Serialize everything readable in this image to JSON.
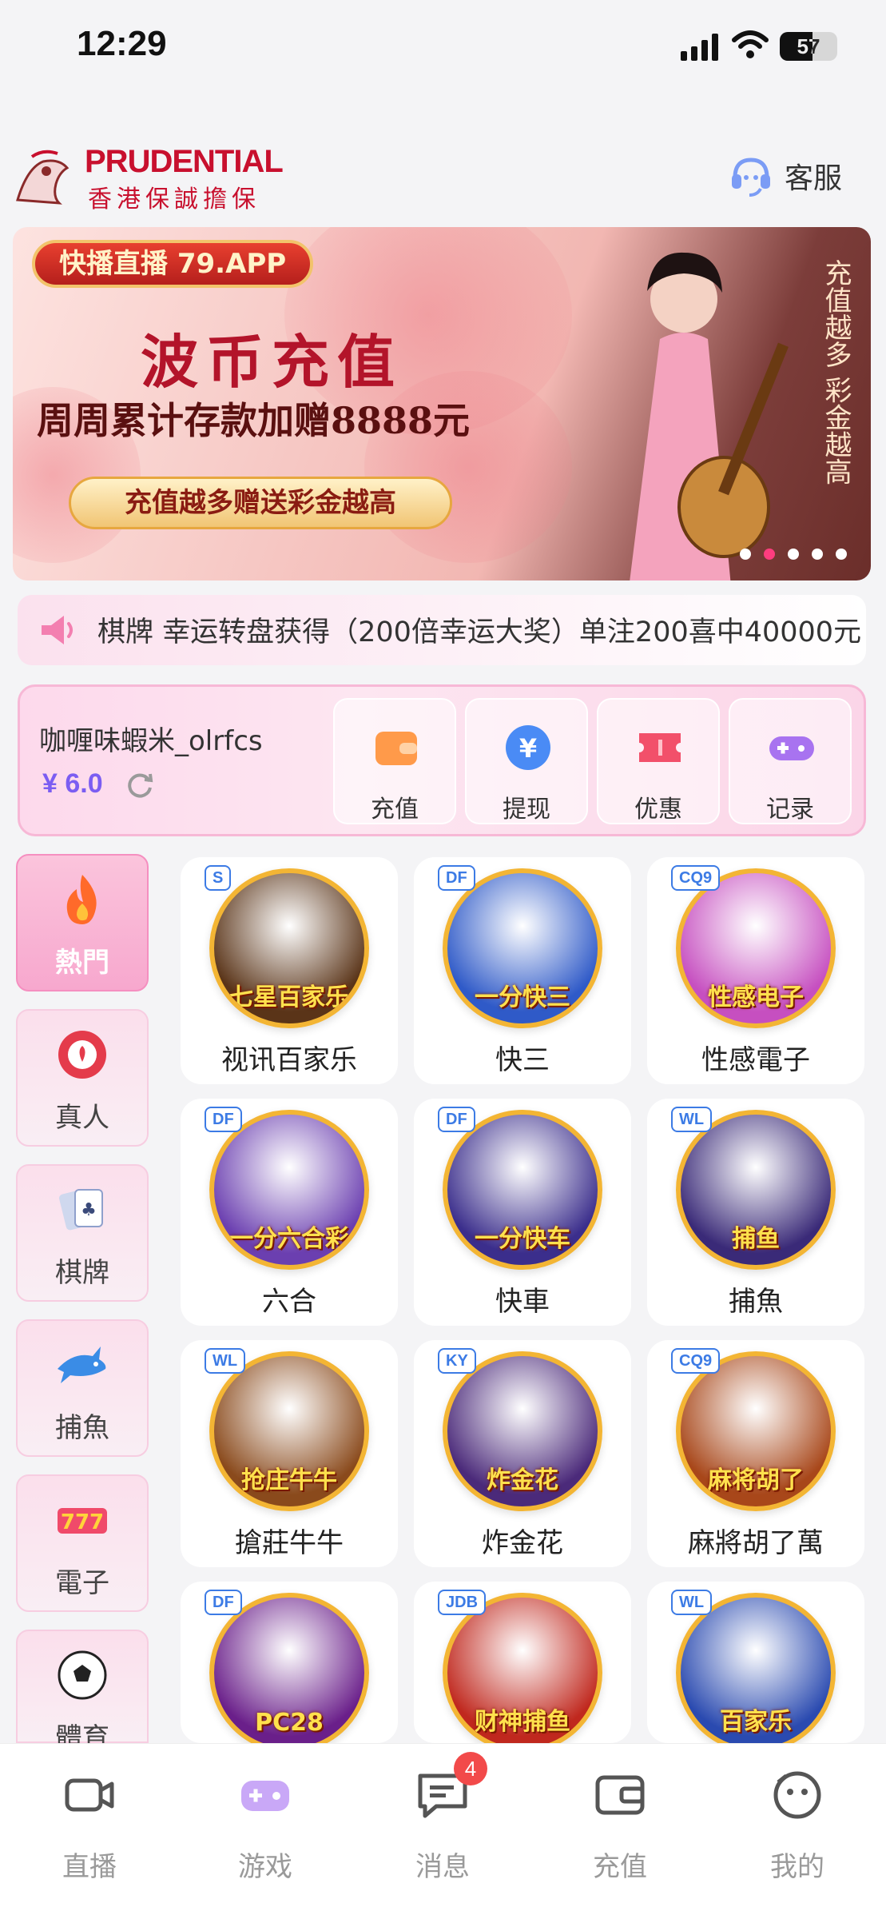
{
  "status_bar": {
    "time": "12:29",
    "battery": "57"
  },
  "header": {
    "brand": "PRUDENTIAL",
    "brand_sub": "香港保誠擔保",
    "support_label": "客服"
  },
  "banner": {
    "tag": "快播直播 79.APP",
    "title": "波币充值",
    "subtitle": "周周累计存款加赠8888元",
    "pill": "充值越多赠送彩金越高",
    "side_text": "充值越多 彩金越高",
    "slide_count": 5,
    "active_slide": 2
  },
  "marquee": {
    "text": "棋牌 幸运转盘获得（200倍幸运大奖）单注200喜中40000元"
  },
  "wallet": {
    "username": "咖喱味蝦米_olrfcs",
    "balance": "¥ 6.0",
    "actions": [
      {
        "label": "充值",
        "icon": "wallet-icon",
        "color": "#ff9a4a"
      },
      {
        "label": "提现",
        "icon": "yen-icon",
        "color": "#4a8bf5"
      },
      {
        "label": "优惠",
        "icon": "ticket-icon",
        "color": "#f2506a"
      },
      {
        "label": "记录",
        "icon": "gamepad-icon",
        "color": "#a873f0"
      }
    ]
  },
  "categories": [
    {
      "label": "熱門",
      "icon": "flame-icon",
      "active": true
    },
    {
      "label": "真人",
      "icon": "chip-icon",
      "active": false
    },
    {
      "label": "棋牌",
      "icon": "cards-icon",
      "active": false
    },
    {
      "label": "捕魚",
      "icon": "shark-icon",
      "active": false
    },
    {
      "label": "電子",
      "icon": "slot-777-icon",
      "active": false
    },
    {
      "label": "體育",
      "icon": "soccer-ball-icon",
      "active": false
    }
  ],
  "games": [
    {
      "label": "视讯百家乐",
      "caption": "七星百家乐",
      "provider": "S",
      "bg": "#5a3418"
    },
    {
      "label": "快三",
      "caption": "一分快三",
      "provider": "DF",
      "bg": "#2f5ac8"
    },
    {
      "label": "性感電子",
      "caption": "性感电子",
      "provider": "CQ9",
      "bg": "#c64fc0"
    },
    {
      "label": "六合",
      "caption": "一分六合彩",
      "provider": "DF",
      "bg": "#6b3fb0"
    },
    {
      "label": "快車",
      "caption": "一分快车",
      "provider": "DF",
      "bg": "#3b2e8c"
    },
    {
      "label": "捕魚",
      "caption": "捕鱼",
      "provider": "WL",
      "bg": "#3a2a78"
    },
    {
      "label": "搶莊牛牛",
      "caption": "抢庄牛牛",
      "provider": "WL",
      "bg": "#8a4a1c"
    },
    {
      "label": "炸金花",
      "caption": "炸金花",
      "provider": "KY",
      "bg": "#4b2a7a"
    },
    {
      "label": "麻將胡了萬",
      "caption": "麻将胡了",
      "provider": "CQ9",
      "bg": "#a8471a"
    },
    {
      "label": "",
      "caption": "PC28",
      "provider": "DF",
      "bg": "#6a1f8a"
    },
    {
      "label": "",
      "caption": "财神捕鱼",
      "provider": "JDB",
      "bg": "#c0281e"
    },
    {
      "label": "",
      "caption": "百家乐",
      "provider": "WL",
      "bg": "#2a4ab0"
    }
  ],
  "tabs": [
    {
      "label": "直播",
      "icon": "camera-icon"
    },
    {
      "label": "游戏",
      "icon": "gamepad-icon"
    },
    {
      "label": "消息",
      "icon": "message-icon",
      "badge": "4"
    },
    {
      "label": "充值",
      "icon": "wallet-icon"
    },
    {
      "label": "我的",
      "icon": "face-icon"
    }
  ]
}
